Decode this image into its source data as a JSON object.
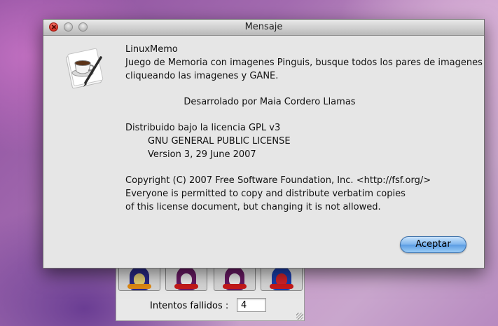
{
  "dialog": {
    "title": "Mensaje",
    "lines": [
      "LinuxMemo",
      "Juego de Memoria con imagenes Pinguis, busque todos los pares de imagenes",
      "cliqueando las imagenes y GANE.",
      "Desarrolado por Maia Cordero Llamas",
      "Distribuido bajo la licencia GPL v3",
      "GNU GENERAL PUBLIC LICENSE",
      "Version 3, 29 June 2007",
      "Copyright (C) 2007 Free Software Foundation, Inc. <http://fsf.org/>",
      "Everyone is permitted to copy and distribute verbatim copies",
      "of this license document, but changing it is not allowed."
    ],
    "accept_label": "Aceptar"
  },
  "game": {
    "fails_label": "Intentos fallidos :",
    "fails_value": "4"
  }
}
